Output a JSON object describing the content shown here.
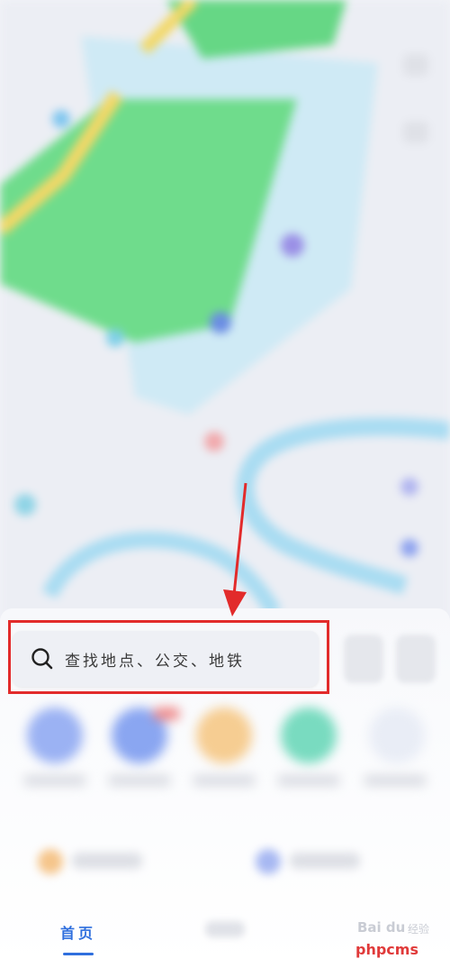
{
  "search": {
    "placeholder": "查找地点、公交、地铁"
  },
  "tabs": {
    "home": "首页"
  },
  "watermark": {
    "logo": "Bai du",
    "jingyan": "经验",
    "site": "phpcms"
  },
  "colors": {
    "accent": "#2f6fde",
    "highlight": "#e22b2b",
    "map_green": "#5ed97a",
    "map_water": "#a9dcf2"
  },
  "icons": {
    "search": "search-icon",
    "arrow": "annotation-arrow-icon"
  }
}
